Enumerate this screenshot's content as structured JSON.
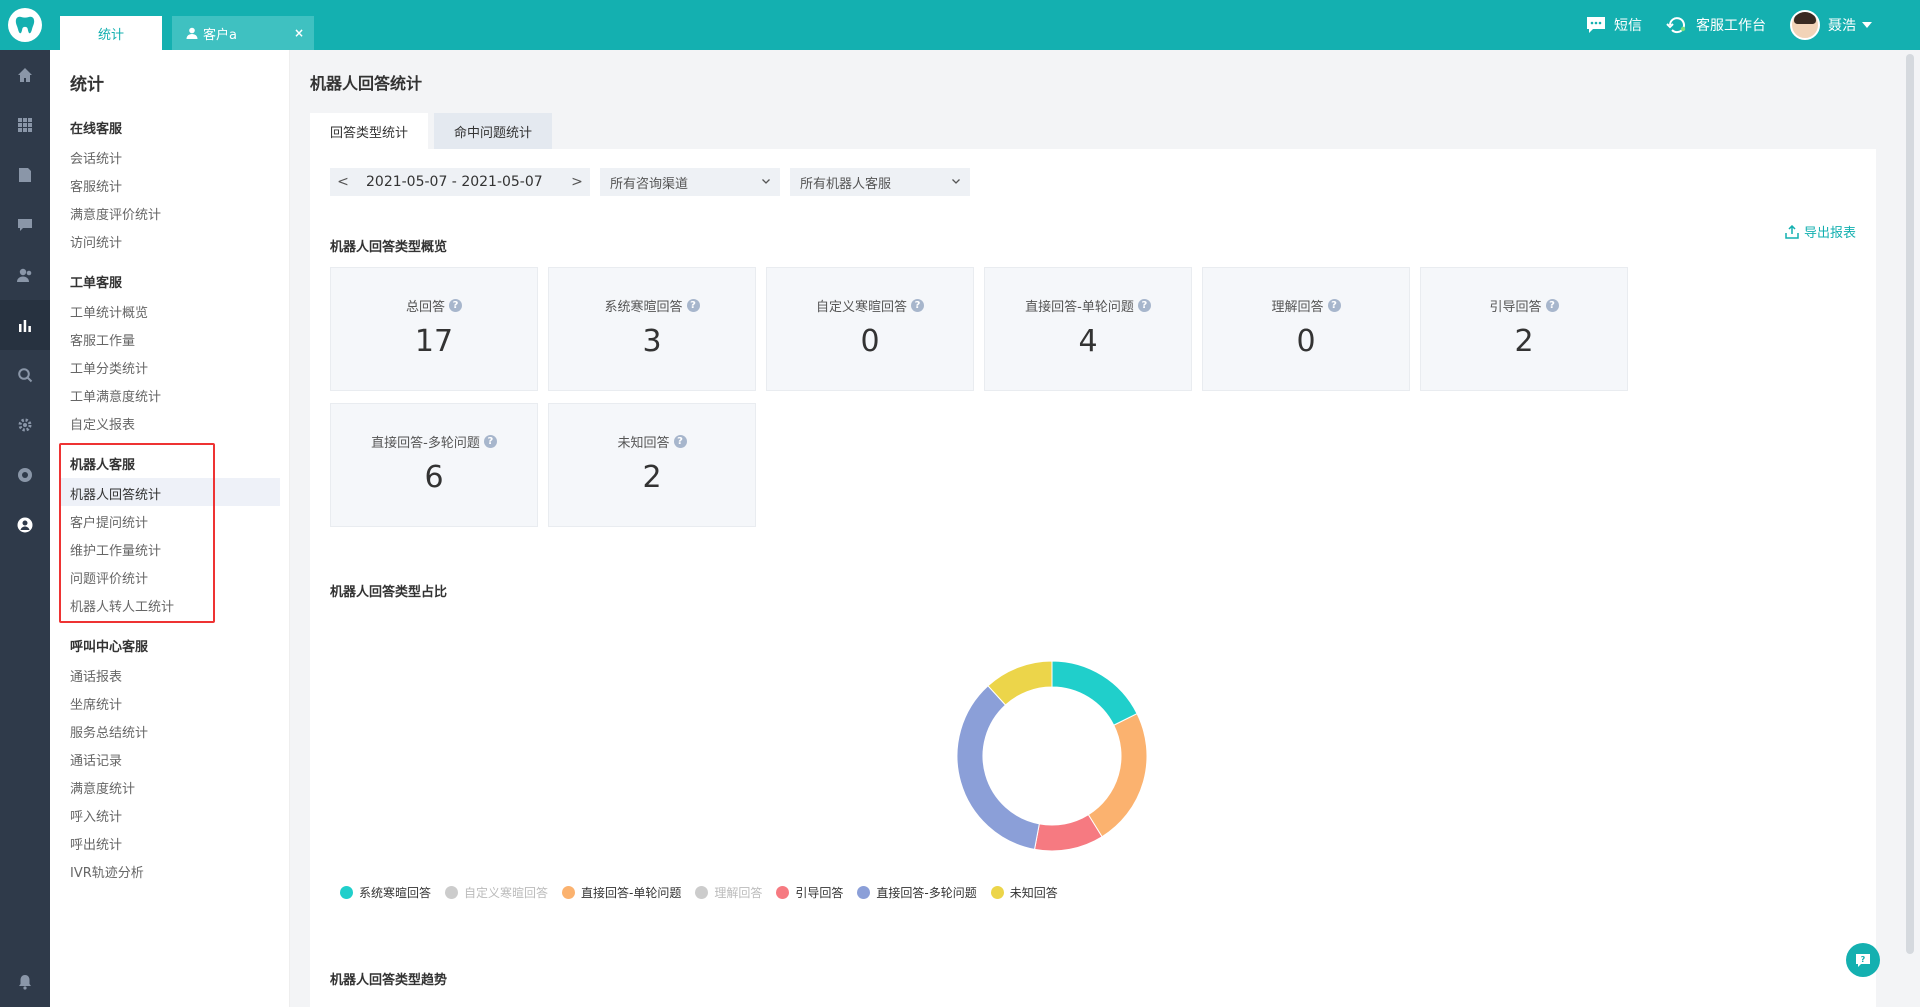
{
  "topbar": {
    "tabs": [
      {
        "label": "统计"
      },
      {
        "label": "客户a",
        "close": "×"
      }
    ],
    "sms_label": "短信",
    "workbench_label": "客服工作台",
    "user_name": "聂浩",
    "colors": {
      "brand": "#14b0b0"
    }
  },
  "iconbar": {
    "items": [
      "home-icon",
      "apps-icon",
      "document-icon",
      "chat-icon",
      "users-icon",
      "stats-icon",
      "search-icon",
      "settings-icon",
      "shield-icon",
      "account-icon",
      "bell-icon"
    ],
    "active": "stats-icon"
  },
  "sidebar": {
    "title": "统计",
    "sections": [
      {
        "title": "在线客服",
        "items": [
          "会话统计",
          "客服统计",
          "满意度评价统计",
          "访问统计"
        ]
      },
      {
        "title": "工单客服",
        "items": [
          "工单统计概览",
          "客服工作量",
          "工单分类统计",
          "工单满意度统计",
          "自定义报表"
        ]
      },
      {
        "title": "机器人客服",
        "items": [
          "机器人回答统计",
          "客户提问统计",
          "维护工作量统计",
          "问题评价统计",
          "机器人转人工统计"
        ]
      },
      {
        "title": "呼叫中心客服",
        "items": [
          "通话报表",
          "坐席统计",
          "服务总结统计",
          "通话记录",
          "满意度统计",
          "呼入统计",
          "呼出统计",
          "IVR轨迹分析"
        ]
      }
    ],
    "active_item": "机器人回答统计"
  },
  "main": {
    "title": "机器人回答统计",
    "tabs": [
      {
        "label": "回答类型统计",
        "active": true
      },
      {
        "label": "命中问题统计",
        "active": false
      }
    ],
    "filters": {
      "prev": "<",
      "next": ">",
      "date_range": "2021-05-07 - 2021-05-07",
      "channel": "所有咨询渠道",
      "robot": "所有机器人客服"
    },
    "overview_title": "机器人回答类型概览",
    "export_label": "导出报表",
    "cards": [
      {
        "label": "总回答",
        "value": "17"
      },
      {
        "label": "系统寒暄回答",
        "value": "3"
      },
      {
        "label": "自定义寒暄回答",
        "value": "0"
      },
      {
        "label": "直接回答-单轮问题",
        "value": "4"
      },
      {
        "label": "理解回答",
        "value": "0"
      },
      {
        "label": "引导回答",
        "value": "2"
      },
      {
        "label": "直接回答-多轮问题",
        "value": "6"
      },
      {
        "label": "未知回答",
        "value": "2"
      }
    ],
    "ratio_title": "机器人回答类型占比",
    "trend_title": "机器人回答类型趋势",
    "help_icon": "?"
  },
  "chart_data": {
    "type": "pie",
    "donut": true,
    "categories": [
      "系统寒暄回答",
      "自定义寒暄回答",
      "直接回答-单轮问题",
      "理解回答",
      "引导回答",
      "直接回答-多轮问题",
      "未知回答"
    ],
    "values": [
      3,
      0,
      4,
      0,
      2,
      6,
      2
    ],
    "colors": [
      "#20cfcb",
      "#cccccc",
      "#fbb26f",
      "#cccccc",
      "#f67a81",
      "#8b9fd8",
      "#ecd54a"
    ],
    "legend_dimmed": [
      false,
      true,
      false,
      true,
      false,
      false,
      false
    ],
    "legend_position": "bottom-left"
  }
}
